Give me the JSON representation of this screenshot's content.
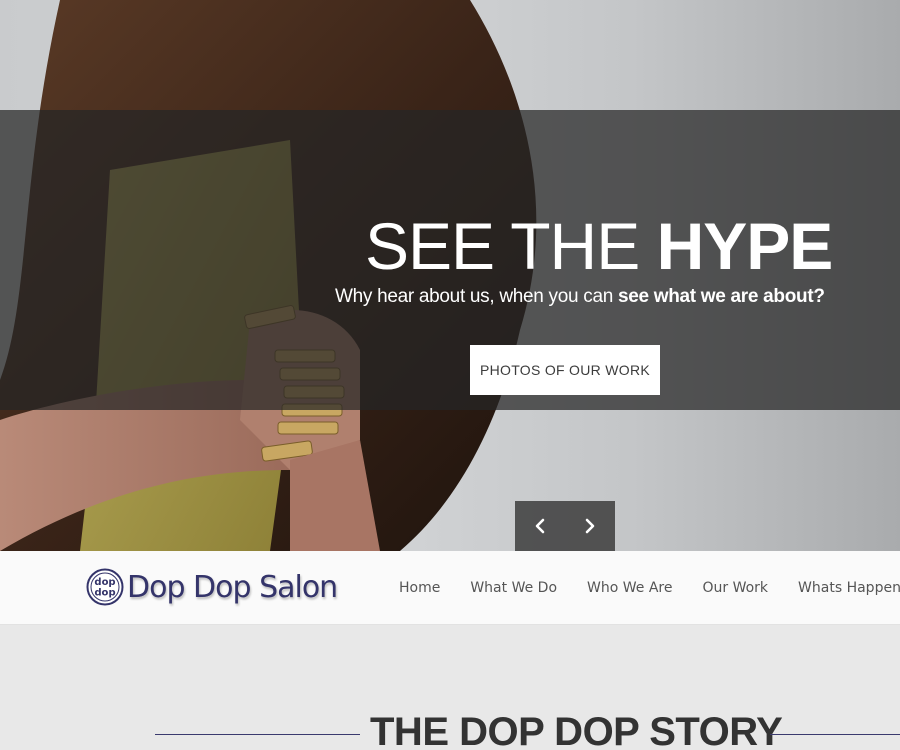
{
  "hero": {
    "headline_light": "SEE THE",
    "headline_bold": "HYPE",
    "subline_regular": "Why hear about us, when you can",
    "subline_bold": "see what we are about?",
    "cta_label": "PHOTOS OF OUR WORK",
    "prev_icon": "chevron-left-icon",
    "next_icon": "chevron-right-icon"
  },
  "navbar": {
    "logo_text": "Dop Dop Salon",
    "logo_mark_text": "dop",
    "links": [
      {
        "label": "Home"
      },
      {
        "label": "What We Do"
      },
      {
        "label": "Who We Are"
      },
      {
        "label": "Our Work"
      },
      {
        "label": "Whats Happening"
      }
    ]
  },
  "story": {
    "title": "THE DOP DOP STORY"
  },
  "colors": {
    "brand": "#34346a",
    "overlay": "#262626",
    "nav_text": "#555555",
    "section_bg": "#e8e8e8"
  }
}
